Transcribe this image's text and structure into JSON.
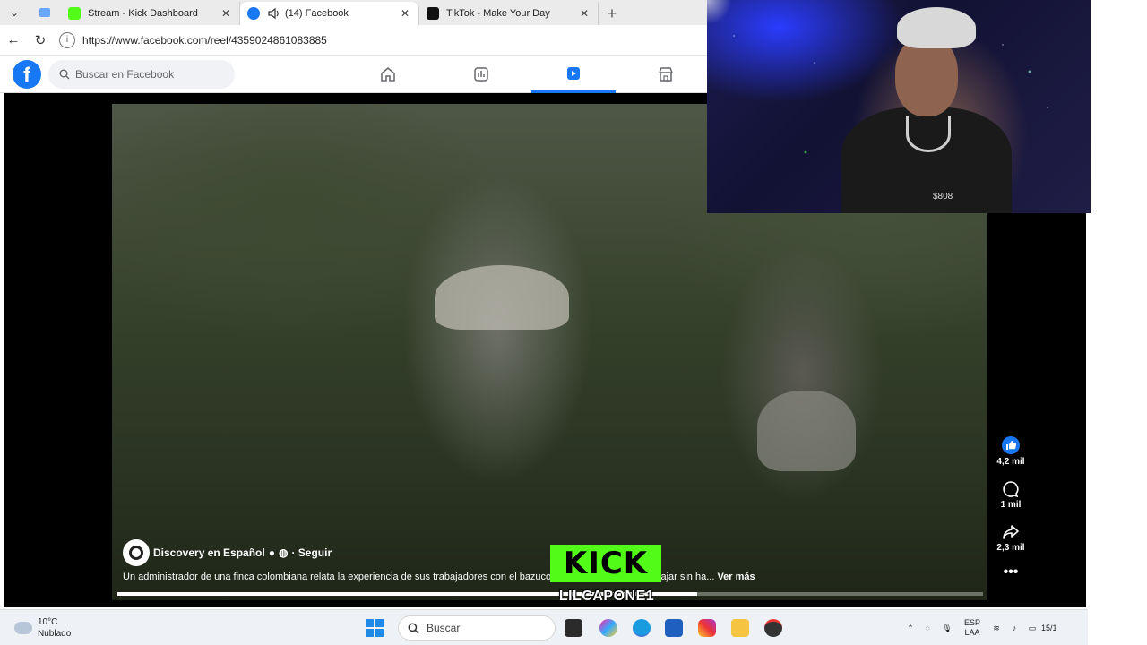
{
  "browser": {
    "tabs": [
      {
        "title": "Stream - Kick Dashboard",
        "icon": "kick-icon",
        "active": false
      },
      {
        "title": "(14) Facebook",
        "icon": "facebook-icon",
        "active": true,
        "muted_icon": "speaker-icon"
      },
      {
        "title": "TikTok - Make Your Day",
        "icon": "tiktok-icon",
        "active": false
      }
    ],
    "close_glyph": "✕",
    "new_tab_glyph": "+",
    "url": "https://www.facebook.com/reel/4359024861083885"
  },
  "facebook": {
    "logo": "f",
    "search_placeholder": "Buscar en Facebook",
    "brand_color": "#1877f2",
    "nav": [
      "home-icon",
      "dashboard-icon",
      "reels-icon",
      "marketplace-icon"
    ],
    "active_nav": "reels-icon"
  },
  "reel": {
    "author": "Discovery en Español",
    "follow": "· Seguir",
    "caption": "Un administrador de una finca colombiana relata la experiencia de sus trabajadores con el bazuco, muchos no podrían trabajar sin ha...",
    "see_more": "Ver más",
    "progress": 0.67,
    "actions": {
      "likes": "4,2 mil",
      "comments": "1 mil",
      "shares": "2,3 mil"
    }
  },
  "overlay": {
    "kick_logo": "KICK",
    "kick_color": "#53fc18",
    "username": "LILCAPONE1",
    "webcam_number": "$808"
  },
  "taskbar": {
    "weather_temp": "10°C",
    "weather_desc": "Nublado",
    "search_label": "Buscar",
    "language": "ESP",
    "layout": "LAA",
    "clock": "15/1"
  }
}
